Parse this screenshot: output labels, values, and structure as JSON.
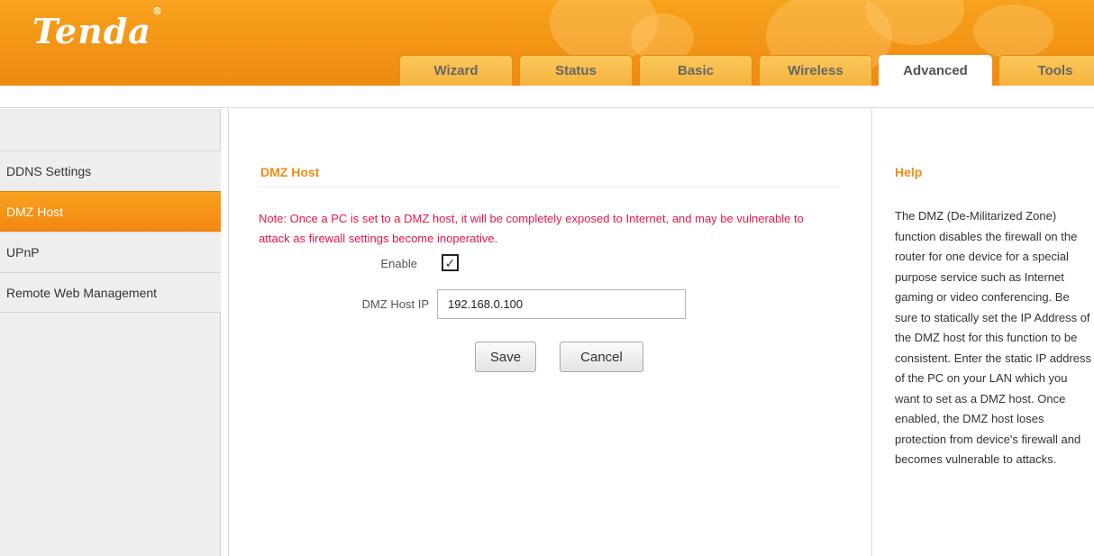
{
  "header": {
    "logo": "Tenda",
    "logo_mark": "®",
    "tabs": [
      {
        "label": "Wizard",
        "active": false
      },
      {
        "label": "Status",
        "active": false
      },
      {
        "label": "Basic",
        "active": false
      },
      {
        "label": "Wireless",
        "active": false
      },
      {
        "label": "Advanced",
        "active": true
      },
      {
        "label": "Tools",
        "active": false
      }
    ]
  },
  "sidebar": {
    "items": [
      {
        "label": "DDNS Settings",
        "active": false
      },
      {
        "label": "DMZ Host",
        "active": true
      },
      {
        "label": "UPnP",
        "active": false
      },
      {
        "label": "Remote Web Management",
        "active": false
      }
    ]
  },
  "main": {
    "title": "DMZ Host",
    "note": "Note: Once a PC is set to a DMZ host, it will be completely exposed to Internet, and may be vulnerable to attack as firewall settings become inoperative.",
    "enable_label": "Enable",
    "enable_checked": true,
    "enable_check_glyph": "✓",
    "dmz_ip_label": "DMZ Host IP",
    "dmz_ip_value": "192.168.0.100",
    "save_label": "Save",
    "cancel_label": "Cancel"
  },
  "help": {
    "title": "Help",
    "text": "The DMZ (De-Militarized Zone) function disables the firewall on the router for one device for a special purpose service such as Internet gaming or video conferencing. Be sure to statically set the IP Address of the DMZ host for this function to be consistent. Enter the static IP address of the PC on your LAN which you want to set as a DMZ host. Once enabled, the DMZ host loses protection from device's firewall and becomes vulnerable to attacks."
  },
  "colors": {
    "brand_orange": "#f39415",
    "title_orange": "#f18c14",
    "warning_red": "#e8164a"
  }
}
